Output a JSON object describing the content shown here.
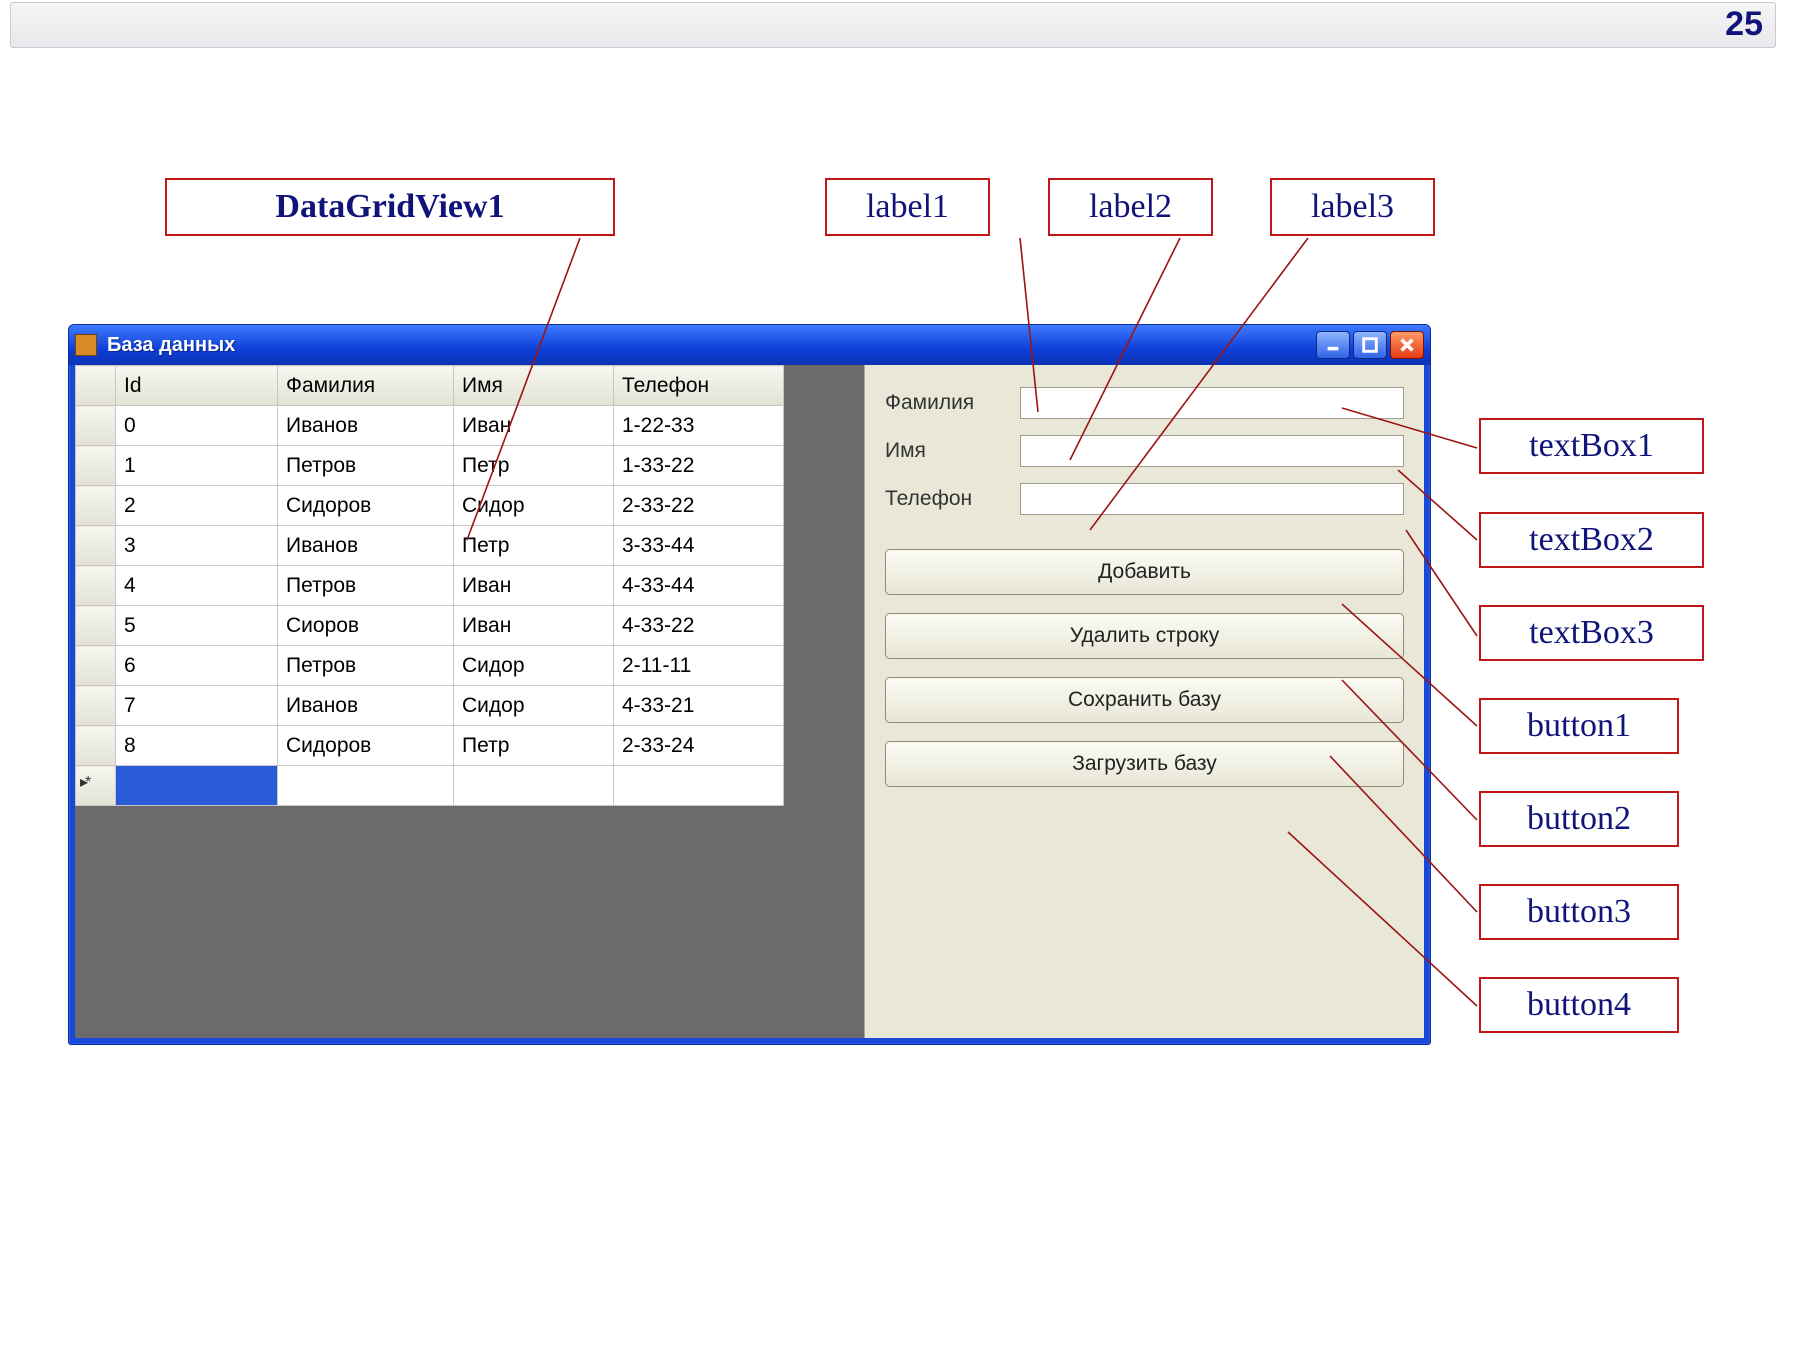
{
  "slide": {
    "page_number": "25"
  },
  "annotations": {
    "datagrid": "DataGridView1",
    "label1": "label1",
    "label2": "label2",
    "label3": "label3",
    "textbox1": "textBox1",
    "textbox2": "textBox2",
    "textbox3": "textBox3",
    "button1": "button1",
    "button2": "button2",
    "button3": "button3",
    "button4": "button4"
  },
  "window": {
    "title": "База данных",
    "grid": {
      "columns": [
        "Id",
        "Фамилия",
        "Имя",
        "Телефон"
      ],
      "rows": [
        {
          "id": "0",
          "fam": "Иванов",
          "nam": "Иван",
          "tel": "1-22-33"
        },
        {
          "id": "1",
          "fam": "Петров",
          "nam": "Петр",
          "tel": "1-33-22"
        },
        {
          "id": "2",
          "fam": "Сидоров",
          "nam": "Сидор",
          "tel": "2-33-22"
        },
        {
          "id": "3",
          "fam": "Иванов",
          "nam": "Петр",
          "tel": "3-33-44"
        },
        {
          "id": "4",
          "fam": "Петров",
          "nam": "Иван",
          "tel": "4-33-44"
        },
        {
          "id": "5",
          "fam": "Сиоров",
          "nam": "Иван",
          "tel": "4-33-22"
        },
        {
          "id": "6",
          "fam": "Петров",
          "nam": "Сидор",
          "tel": "2-11-11"
        },
        {
          "id": "7",
          "fam": "Иванов",
          "nam": "Сидор",
          "tel": "4-33-21"
        },
        {
          "id": "8",
          "fam": "Сидоров",
          "nam": "Петр",
          "tel": "2-33-24"
        }
      ]
    },
    "form": {
      "label_surname": "Фамилия",
      "label_name": "Имя",
      "label_phone": "Телефон",
      "value_surname": "",
      "value_name": "",
      "value_phone": "",
      "btn_add": "Добавить",
      "btn_delete": "Удалить строку",
      "btn_save": "Сохранить базу",
      "btn_load": "Загрузить базу"
    }
  }
}
